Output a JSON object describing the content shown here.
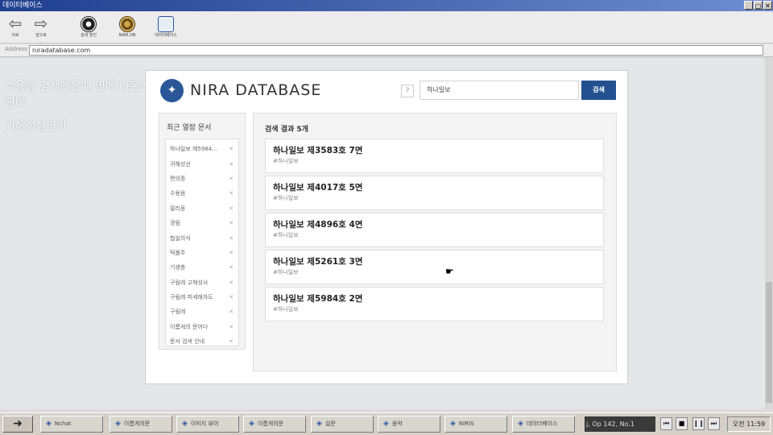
{
  "window": {
    "title": "데이터베이스",
    "buttons": [
      "_",
      "▢",
      "✕"
    ]
  },
  "toolbar": {
    "back_label": "뒤로",
    "forward_label": "앞으로",
    "btn3_label": "검색 엔진",
    "btn4_label": "NIRA DB",
    "btn5_label": "데이터베이스"
  },
  "address": {
    "label": "Address",
    "value": "niradatabase.com"
  },
  "overlay": {
    "line1": "수용음 검색했을때 밑에 나온거",
    "line2": "던데",
    "line3": "귀해성선인가"
  },
  "page": {
    "brand": "NIRA DATABASE",
    "help": "?",
    "search_value": "하나일보",
    "search_button": "검색",
    "recent_title": "최근 열람 문서",
    "recent_items": [
      "하나일보 제5984...",
      "귀해성선",
      "편의증",
      "수용음",
      "필리동",
      "경림",
      "협실의식",
      "떡볼주",
      "기생충",
      "구림레 고해성사",
      "구림레 피세례자도",
      "구림레",
      "이름게의 문어다",
      "문서 검색 안내"
    ],
    "results_title": "검색 결과 5개",
    "results": [
      {
        "title": "하나일보 제3583호 7면",
        "tag": "#하나일보"
      },
      {
        "title": "하나일보 제4017호 5면",
        "tag": "#하나일보"
      },
      {
        "title": "하나일보 제4896호 4면",
        "tag": "#하나일보"
      },
      {
        "title": "하나일보 제5261호 3면",
        "tag": "#하나일보"
      },
      {
        "title": "하나일보 제5984호 2면",
        "tag": "#하나일보"
      }
    ]
  },
  "taskbar": {
    "tasks": [
      "Nchat",
      "이름게의문",
      "이미지 뷰어",
      "이름게의문",
      "설문",
      "음악",
      "NIRIS",
      "데이터베이스"
    ],
    "now_playing": "j, Op 142, No.1",
    "clock": "오전 11:59"
  },
  "colors": {
    "accent": "#23518f",
    "logo": "#2b5799"
  }
}
